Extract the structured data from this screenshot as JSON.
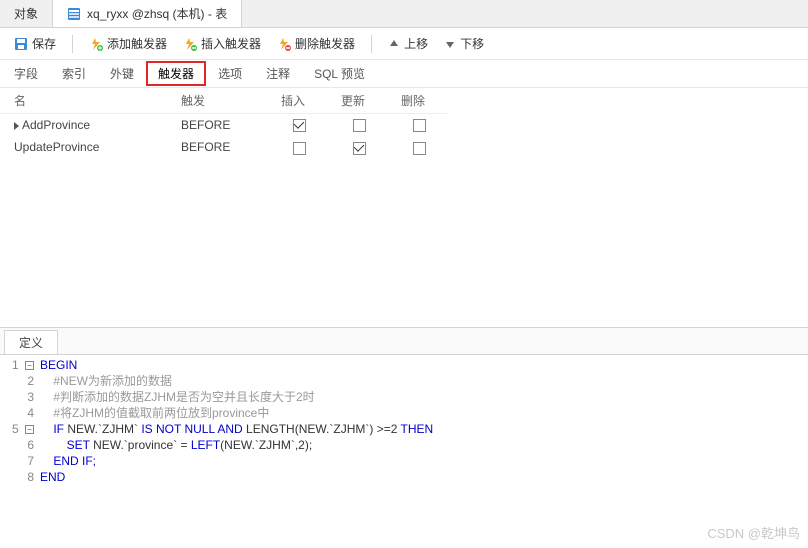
{
  "tabs": {
    "objects": "对象",
    "active_title": "xq_ryxx @zhsq (本机) - 表"
  },
  "toolbar": {
    "save": "保存",
    "add_trigger": "添加触发器",
    "insert_trigger": "插入触发器",
    "delete_trigger": "删除触发器",
    "move_up": "上移",
    "move_down": "下移"
  },
  "subtabs": {
    "fields": "字段",
    "indexes": "索引",
    "fk": "外键",
    "triggers": "触发器",
    "options": "选项",
    "comment": "注释",
    "sql": "SQL 预览"
  },
  "grid": {
    "headers": {
      "name": "名",
      "trigger": "触发",
      "insert": "插入",
      "update": "更新",
      "delete": "删除"
    },
    "rows": [
      {
        "name": "AddProvince",
        "trigger": "BEFORE",
        "insert": true,
        "update": false,
        "delete": false,
        "current": true
      },
      {
        "name": "UpdateProvince",
        "trigger": "BEFORE",
        "insert": false,
        "update": true,
        "delete": false,
        "current": false
      }
    ]
  },
  "def_tab": "定义",
  "code": {
    "l1": "BEGIN",
    "l2": "    #NEW为新添加的数据",
    "l3": "    #判断添加的数据ZJHM是否为空并且长度大于2时",
    "l4": "    #将ZJHM的值截取前两位放到province中",
    "l5_a": "    IF",
    "l5_b": " NEW.`ZJHM` ",
    "l5_c": "IS NOT NULL AND",
    "l5_d": " LENGTH",
    "l5_e": "(NEW.`ZJHM`) >=2 ",
    "l5_f": "THEN",
    "l6_a": "        SET",
    "l6_b": " NEW.`province` = ",
    "l6_c": "LEFT",
    "l6_d": "(NEW.`ZJHM`,2);",
    "l7": "    END IF;",
    "l8": "END"
  },
  "watermark": "CSDN @乾坤鸟"
}
